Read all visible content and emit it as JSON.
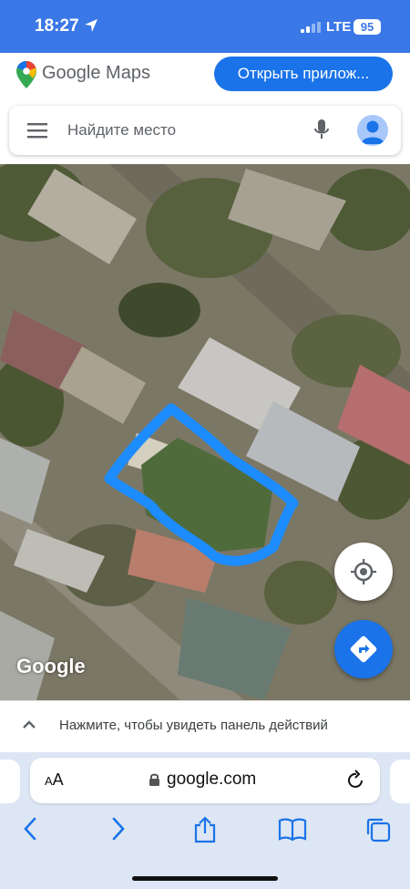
{
  "status_bar": {
    "time": "18:27",
    "network": "LTE",
    "battery": "95"
  },
  "header": {
    "logo_text": "Google Maps",
    "open_app_label": "Открыть прилож..."
  },
  "search": {
    "placeholder": "Найдите место"
  },
  "map": {
    "watermark": "Google"
  },
  "bottom_panel": {
    "hint": "Нажмите, чтобы увидеть панель действий"
  },
  "browser": {
    "aa_small": "A",
    "aa_large": "A",
    "url": "google.com"
  },
  "colors": {
    "status_blue": "#3b78e7",
    "button_blue": "#1a73e8",
    "outline_blue": "#1c8cff"
  },
  "icons": [
    "location-arrow-icon",
    "signal-icon",
    "maps-pin-icon",
    "menu-icon",
    "microphone-icon",
    "avatar-icon",
    "my-location-icon",
    "directions-icon",
    "chevron-up-icon",
    "lock-icon",
    "reload-icon",
    "back-icon",
    "forward-icon",
    "share-icon",
    "bookmarks-icon",
    "tabs-icon"
  ]
}
